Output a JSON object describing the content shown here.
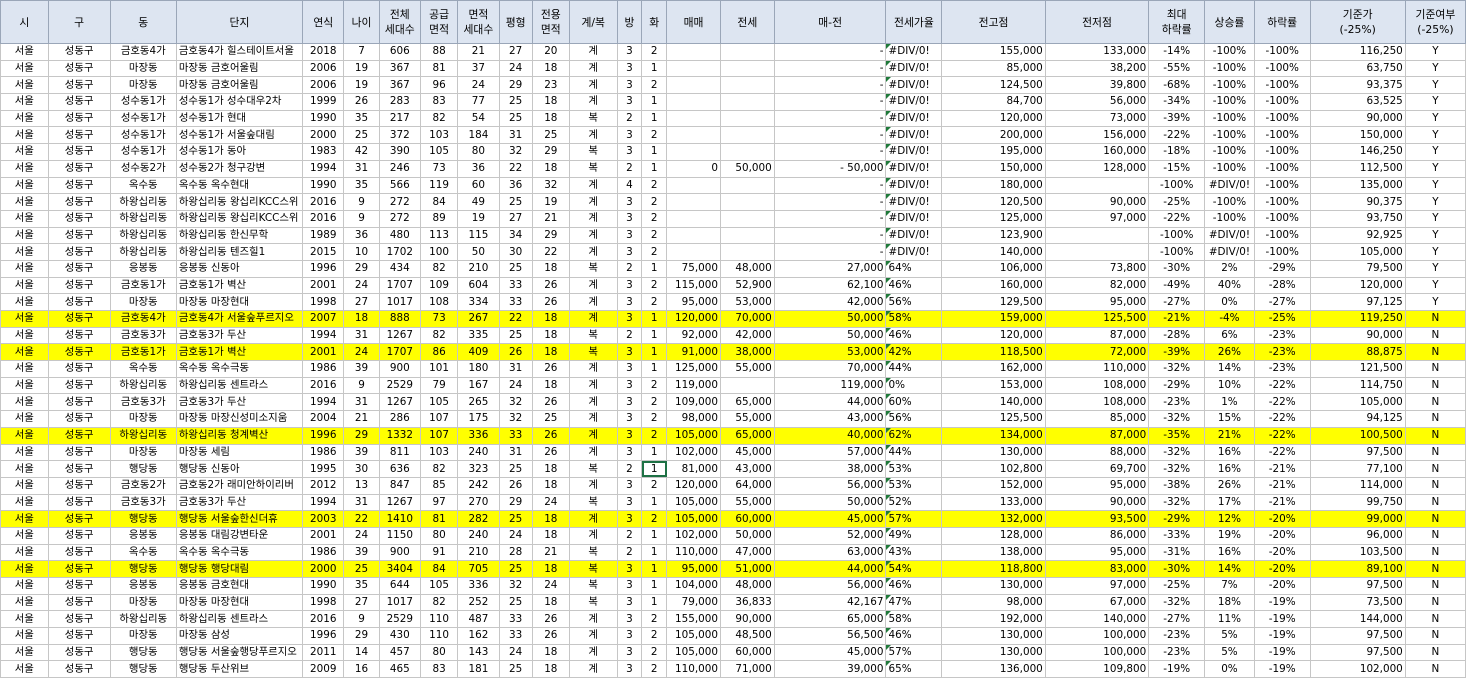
{
  "columns": [
    "시",
    "구",
    "동",
    "단지",
    "연식",
    "나이",
    "전체\n세대수",
    "공급\n면적",
    "면적\n세대수",
    "평형",
    "전용\n면적",
    "계/복",
    "방",
    "화",
    "매매",
    "전세",
    "매-전",
    "전세가율",
    "전고점",
    "전저점",
    "최대\n하락률",
    "상승률",
    "하락률",
    "기준가\n(-25%)",
    "기준여부\n(-25%)"
  ],
  "rows": [
    [
      "서울",
      "성동구",
      "금호동4가",
      "금호동4가 힐스테이트서울",
      "2018",
      "7",
      "606",
      "88",
      "21",
      "27",
      "20",
      "계",
      "3",
      "2",
      "",
      "",
      "-",
      "#DIV/0!",
      "155,000",
      "133,000",
      "-14%",
      "-100%",
      "-100%",
      "116,250",
      "Y"
    ],
    [
      "서울",
      "성동구",
      "마장동",
      "마장동 금호어울림",
      "2006",
      "19",
      "367",
      "81",
      "37",
      "24",
      "18",
      "계",
      "3",
      "1",
      "",
      "",
      "-",
      "#DIV/0!",
      "85,000",
      "38,200",
      "-55%",
      "-100%",
      "-100%",
      "63,750",
      "Y"
    ],
    [
      "서울",
      "성동구",
      "마장동",
      "마장동 금호어울림",
      "2006",
      "19",
      "367",
      "96",
      "24",
      "29",
      "23",
      "계",
      "3",
      "2",
      "",
      "",
      "-",
      "#DIV/0!",
      "124,500",
      "39,800",
      "-68%",
      "-100%",
      "-100%",
      "93,375",
      "Y"
    ],
    [
      "서울",
      "성동구",
      "성수동1가",
      "성수동1가 성수대우2차",
      "1999",
      "26",
      "283",
      "83",
      "77",
      "25",
      "18",
      "계",
      "3",
      "1",
      "",
      "",
      "-",
      "#DIV/0!",
      "84,700",
      "56,000",
      "-34%",
      "-100%",
      "-100%",
      "63,525",
      "Y"
    ],
    [
      "서울",
      "성동구",
      "성수동1가",
      "성수동1가 현대",
      "1990",
      "35",
      "217",
      "82",
      "54",
      "25",
      "18",
      "복",
      "2",
      "1",
      "",
      "",
      "-",
      "#DIV/0!",
      "120,000",
      "73,000",
      "-39%",
      "-100%",
      "-100%",
      "90,000",
      "Y"
    ],
    [
      "서울",
      "성동구",
      "성수동1가",
      "성수동1가 서울숲대림",
      "2000",
      "25",
      "372",
      "103",
      "184",
      "31",
      "25",
      "계",
      "3",
      "2",
      "",
      "",
      "-",
      "#DIV/0!",
      "200,000",
      "156,000",
      "-22%",
      "-100%",
      "-100%",
      "150,000",
      "Y"
    ],
    [
      "서울",
      "성동구",
      "성수동1가",
      "성수동1가 동아",
      "1983",
      "42",
      "390",
      "105",
      "80",
      "32",
      "29",
      "복",
      "3",
      "1",
      "",
      "",
      "-",
      "#DIV/0!",
      "195,000",
      "160,000",
      "-18%",
      "-100%",
      "-100%",
      "146,250",
      "Y"
    ],
    [
      "서울",
      "성동구",
      "성수동2가",
      "성수동2가 청구강변",
      "1994",
      "31",
      "246",
      "73",
      "36",
      "22",
      "18",
      "복",
      "2",
      "1",
      "0",
      "50,000",
      "-      50,000",
      "#DIV/0!",
      "150,000",
      "128,000",
      "-15%",
      "-100%",
      "-100%",
      "112,500",
      "Y"
    ],
    [
      "서울",
      "성동구",
      "옥수동",
      "옥수동 옥수현대",
      "1990",
      "35",
      "566",
      "119",
      "60",
      "36",
      "32",
      "계",
      "4",
      "2",
      "",
      "",
      "-",
      "#DIV/0!",
      "180,000",
      "",
      "-100%",
      "#DIV/0!",
      "-100%",
      "135,000",
      "Y"
    ],
    [
      "서울",
      "성동구",
      "하왕십리동",
      "하왕십리동 왕십리KCC스위",
      "2016",
      "9",
      "272",
      "84",
      "49",
      "25",
      "19",
      "계",
      "3",
      "2",
      "",
      "",
      "-",
      "#DIV/0!",
      "120,500",
      "90,000",
      "-25%",
      "-100%",
      "-100%",
      "90,375",
      "Y"
    ],
    [
      "서울",
      "성동구",
      "하왕십리동",
      "하왕십리동 왕십리KCC스위",
      "2016",
      "9",
      "272",
      "89",
      "19",
      "27",
      "21",
      "계",
      "3",
      "2",
      "",
      "",
      "-",
      "#DIV/0!",
      "125,000",
      "97,000",
      "-22%",
      "-100%",
      "-100%",
      "93,750",
      "Y"
    ],
    [
      "서울",
      "성동구",
      "하왕십리동",
      "하왕십리동 한신무학",
      "1989",
      "36",
      "480",
      "113",
      "115",
      "34",
      "29",
      "계",
      "3",
      "2",
      "",
      "",
      "-",
      "#DIV/0!",
      "123,900",
      "",
      "-100%",
      "#DIV/0!",
      "-100%",
      "92,925",
      "Y"
    ],
    [
      "서울",
      "성동구",
      "하왕십리동",
      "하왕십리동 텐즈힐1",
      "2015",
      "10",
      "1702",
      "100",
      "50",
      "30",
      "22",
      "계",
      "3",
      "2",
      "",
      "",
      "-",
      "#DIV/0!",
      "140,000",
      "",
      "-100%",
      "#DIV/0!",
      "-100%",
      "105,000",
      "Y"
    ],
    [
      "서울",
      "성동구",
      "응봉동",
      "응봉동 신동아",
      "1996",
      "29",
      "434",
      "82",
      "210",
      "25",
      "18",
      "복",
      "2",
      "1",
      "75,000",
      "48,000",
      "27,000",
      "64%",
      "106,000",
      "73,800",
      "-30%",
      "2%",
      "-29%",
      "79,500",
      "Y"
    ],
    [
      "서울",
      "성동구",
      "금호동1가",
      "금호동1가 벽산",
      "2001",
      "24",
      "1707",
      "109",
      "604",
      "33",
      "26",
      "계",
      "3",
      "2",
      "115,000",
      "52,900",
      "62,100",
      "46%",
      "160,000",
      "82,000",
      "-49%",
      "40%",
      "-28%",
      "120,000",
      "Y"
    ],
    [
      "서울",
      "성동구",
      "마장동",
      "마장동 마장현대",
      "1998",
      "27",
      "1017",
      "108",
      "334",
      "33",
      "26",
      "계",
      "3",
      "2",
      "95,000",
      "53,000",
      "42,000",
      "56%",
      "129,500",
      "95,000",
      "-27%",
      "0%",
      "-27%",
      "97,125",
      "Y"
    ],
    [
      "서울",
      "성동구",
      "금호동4가",
      "금호동4가 서울숲푸르지오",
      "2007",
      "18",
      "888",
      "73",
      "267",
      "22",
      "18",
      "계",
      "3",
      "1",
      "120,000",
      "70,000",
      "50,000",
      "58%",
      "159,000",
      "125,500",
      "-21%",
      "-4%",
      "-25%",
      "119,250",
      "N"
    ],
    [
      "서울",
      "성동구",
      "금호동3가",
      "금호동3가 두산",
      "1994",
      "31",
      "1267",
      "82",
      "335",
      "25",
      "18",
      "복",
      "2",
      "1",
      "92,000",
      "42,000",
      "50,000",
      "46%",
      "120,000",
      "87,000",
      "-28%",
      "6%",
      "-23%",
      "90,000",
      "N"
    ],
    [
      "서울",
      "성동구",
      "금호동1가",
      "금호동1가 벽산",
      "2001",
      "24",
      "1707",
      "86",
      "409",
      "26",
      "18",
      "복",
      "3",
      "1",
      "91,000",
      "38,000",
      "53,000",
      "42%",
      "118,500",
      "72,000",
      "-39%",
      "26%",
      "-23%",
      "88,875",
      "N"
    ],
    [
      "서울",
      "성동구",
      "옥수동",
      "옥수동 옥수극동",
      "1986",
      "39",
      "900",
      "101",
      "180",
      "31",
      "26",
      "계",
      "3",
      "1",
      "125,000",
      "55,000",
      "70,000",
      "44%",
      "162,000",
      "110,000",
      "-32%",
      "14%",
      "-23%",
      "121,500",
      "N"
    ],
    [
      "서울",
      "성동구",
      "하왕십리동",
      "하왕십리동 센트라스",
      "2016",
      "9",
      "2529",
      "79",
      "167",
      "24",
      "18",
      "계",
      "3",
      "2",
      "119,000",
      "",
      "119,000",
      "0%",
      "153,000",
      "108,000",
      "-29%",
      "10%",
      "-22%",
      "114,750",
      "N"
    ],
    [
      "서울",
      "성동구",
      "금호동3가",
      "금호동3가 두산",
      "1994",
      "31",
      "1267",
      "105",
      "265",
      "32",
      "26",
      "계",
      "3",
      "2",
      "109,000",
      "65,000",
      "44,000",
      "60%",
      "140,000",
      "108,000",
      "-23%",
      "1%",
      "-22%",
      "105,000",
      "N"
    ],
    [
      "서울",
      "성동구",
      "마장동",
      "마장동 마장신성미소지움",
      "2004",
      "21",
      "286",
      "107",
      "175",
      "32",
      "25",
      "계",
      "3",
      "2",
      "98,000",
      "55,000",
      "43,000",
      "56%",
      "125,500",
      "85,000",
      "-32%",
      "15%",
      "-22%",
      "94,125",
      "N"
    ],
    [
      "서울",
      "성동구",
      "하왕십리동",
      "하왕십리동 청계벽산",
      "1996",
      "29",
      "1332",
      "107",
      "336",
      "33",
      "26",
      "계",
      "3",
      "2",
      "105,000",
      "65,000",
      "40,000",
      "62%",
      "134,000",
      "87,000",
      "-35%",
      "21%",
      "-22%",
      "100,500",
      "N"
    ],
    [
      "서울",
      "성동구",
      "마장동",
      "마장동 세림",
      "1986",
      "39",
      "811",
      "103",
      "240",
      "31",
      "26",
      "계",
      "3",
      "1",
      "102,000",
      "45,000",
      "57,000",
      "44%",
      "130,000",
      "88,000",
      "-32%",
      "16%",
      "-22%",
      "97,500",
      "N"
    ],
    [
      "서울",
      "성동구",
      "행당동",
      "행당동 신동아",
      "1995",
      "30",
      "636",
      "82",
      "323",
      "25",
      "18",
      "복",
      "2",
      "1",
      "81,000",
      "43,000",
      "38,000",
      "53%",
      "102,800",
      "69,700",
      "-32%",
      "16%",
      "-21%",
      "77,100",
      "N"
    ],
    [
      "서울",
      "성동구",
      "금호동2가",
      "금호동2가 래미안하이리버",
      "2012",
      "13",
      "847",
      "85",
      "242",
      "26",
      "18",
      "계",
      "3",
      "2",
      "120,000",
      "64,000",
      "56,000",
      "53%",
      "152,000",
      "95,000",
      "-38%",
      "26%",
      "-21%",
      "114,000",
      "N"
    ],
    [
      "서울",
      "성동구",
      "금호동3가",
      "금호동3가 두산",
      "1994",
      "31",
      "1267",
      "97",
      "270",
      "29",
      "24",
      "복",
      "3",
      "1",
      "105,000",
      "55,000",
      "50,000",
      "52%",
      "133,000",
      "90,000",
      "-32%",
      "17%",
      "-21%",
      "99,750",
      "N"
    ],
    [
      "서울",
      "성동구",
      "행당동",
      "행당동 서울숲한신더휴",
      "2003",
      "22",
      "1410",
      "81",
      "282",
      "25",
      "18",
      "계",
      "3",
      "2",
      "105,000",
      "60,000",
      "45,000",
      "57%",
      "132,000",
      "93,500",
      "-29%",
      "12%",
      "-20%",
      "99,000",
      "N"
    ],
    [
      "서울",
      "성동구",
      "응봉동",
      "응봉동 대림강변타운",
      "2001",
      "24",
      "1150",
      "80",
      "240",
      "24",
      "18",
      "계",
      "2",
      "1",
      "102,000",
      "50,000",
      "52,000",
      "49%",
      "128,000",
      "86,000",
      "-33%",
      "19%",
      "-20%",
      "96,000",
      "N"
    ],
    [
      "서울",
      "성동구",
      "옥수동",
      "옥수동 옥수극동",
      "1986",
      "39",
      "900",
      "91",
      "210",
      "28",
      "21",
      "복",
      "2",
      "1",
      "110,000",
      "47,000",
      "63,000",
      "43%",
      "138,000",
      "95,000",
      "-31%",
      "16%",
      "-20%",
      "103,500",
      "N"
    ],
    [
      "서울",
      "성동구",
      "행당동",
      "행당동 행당대림",
      "2000",
      "25",
      "3404",
      "84",
      "705",
      "25",
      "18",
      "복",
      "3",
      "1",
      "95,000",
      "51,000",
      "44,000",
      "54%",
      "118,800",
      "83,000",
      "-30%",
      "14%",
      "-20%",
      "89,100",
      "N"
    ],
    [
      "서울",
      "성동구",
      "응봉동",
      "응봉동 금호현대",
      "1990",
      "35",
      "644",
      "105",
      "336",
      "32",
      "24",
      "복",
      "3",
      "1",
      "104,000",
      "48,000",
      "56,000",
      "46%",
      "130,000",
      "97,000",
      "-25%",
      "7%",
      "-20%",
      "97,500",
      "N"
    ],
    [
      "서울",
      "성동구",
      "마장동",
      "마장동 마장현대",
      "1998",
      "27",
      "1017",
      "82",
      "252",
      "25",
      "18",
      "복",
      "3",
      "1",
      "79,000",
      "36,833",
      "42,167",
      "47%",
      "98,000",
      "67,000",
      "-32%",
      "18%",
      "-19%",
      "73,500",
      "N"
    ],
    [
      "서울",
      "성동구",
      "하왕십리동",
      "하왕십리동 센트라스",
      "2016",
      "9",
      "2529",
      "110",
      "487",
      "33",
      "26",
      "계",
      "3",
      "2",
      "155,000",
      "90,000",
      "65,000",
      "58%",
      "192,000",
      "140,000",
      "-27%",
      "11%",
      "-19%",
      "144,000",
      "N"
    ],
    [
      "서울",
      "성동구",
      "마장동",
      "마장동 삼성",
      "1996",
      "29",
      "430",
      "110",
      "162",
      "33",
      "26",
      "계",
      "3",
      "2",
      "105,000",
      "48,500",
      "56,500",
      "46%",
      "130,000",
      "100,000",
      "-23%",
      "5%",
      "-19%",
      "97,500",
      "N"
    ],
    [
      "서울",
      "성동구",
      "행당동",
      "행당동 서울숲행당푸르지오",
      "2011",
      "14",
      "457",
      "80",
      "143",
      "24",
      "18",
      "계",
      "3",
      "2",
      "105,000",
      "60,000",
      "45,000",
      "57%",
      "130,000",
      "100,000",
      "-23%",
      "5%",
      "-19%",
      "97,500",
      "N"
    ],
    [
      "서울",
      "성동구",
      "행당동",
      "행당동 두산위브",
      "2009",
      "16",
      "465",
      "83",
      "181",
      "25",
      "18",
      "계",
      "3",
      "2",
      "110,000",
      "71,000",
      "39,000",
      "65%",
      "136,000",
      "109,800",
      "-19%",
      "0%",
      "-19%",
      "102,000",
      "N"
    ]
  ],
  "highlighted_rows": [
    16,
    18,
    23,
    28,
    31
  ],
  "highlight_color": "#ffff00",
  "header_color": "#dde5f1"
}
